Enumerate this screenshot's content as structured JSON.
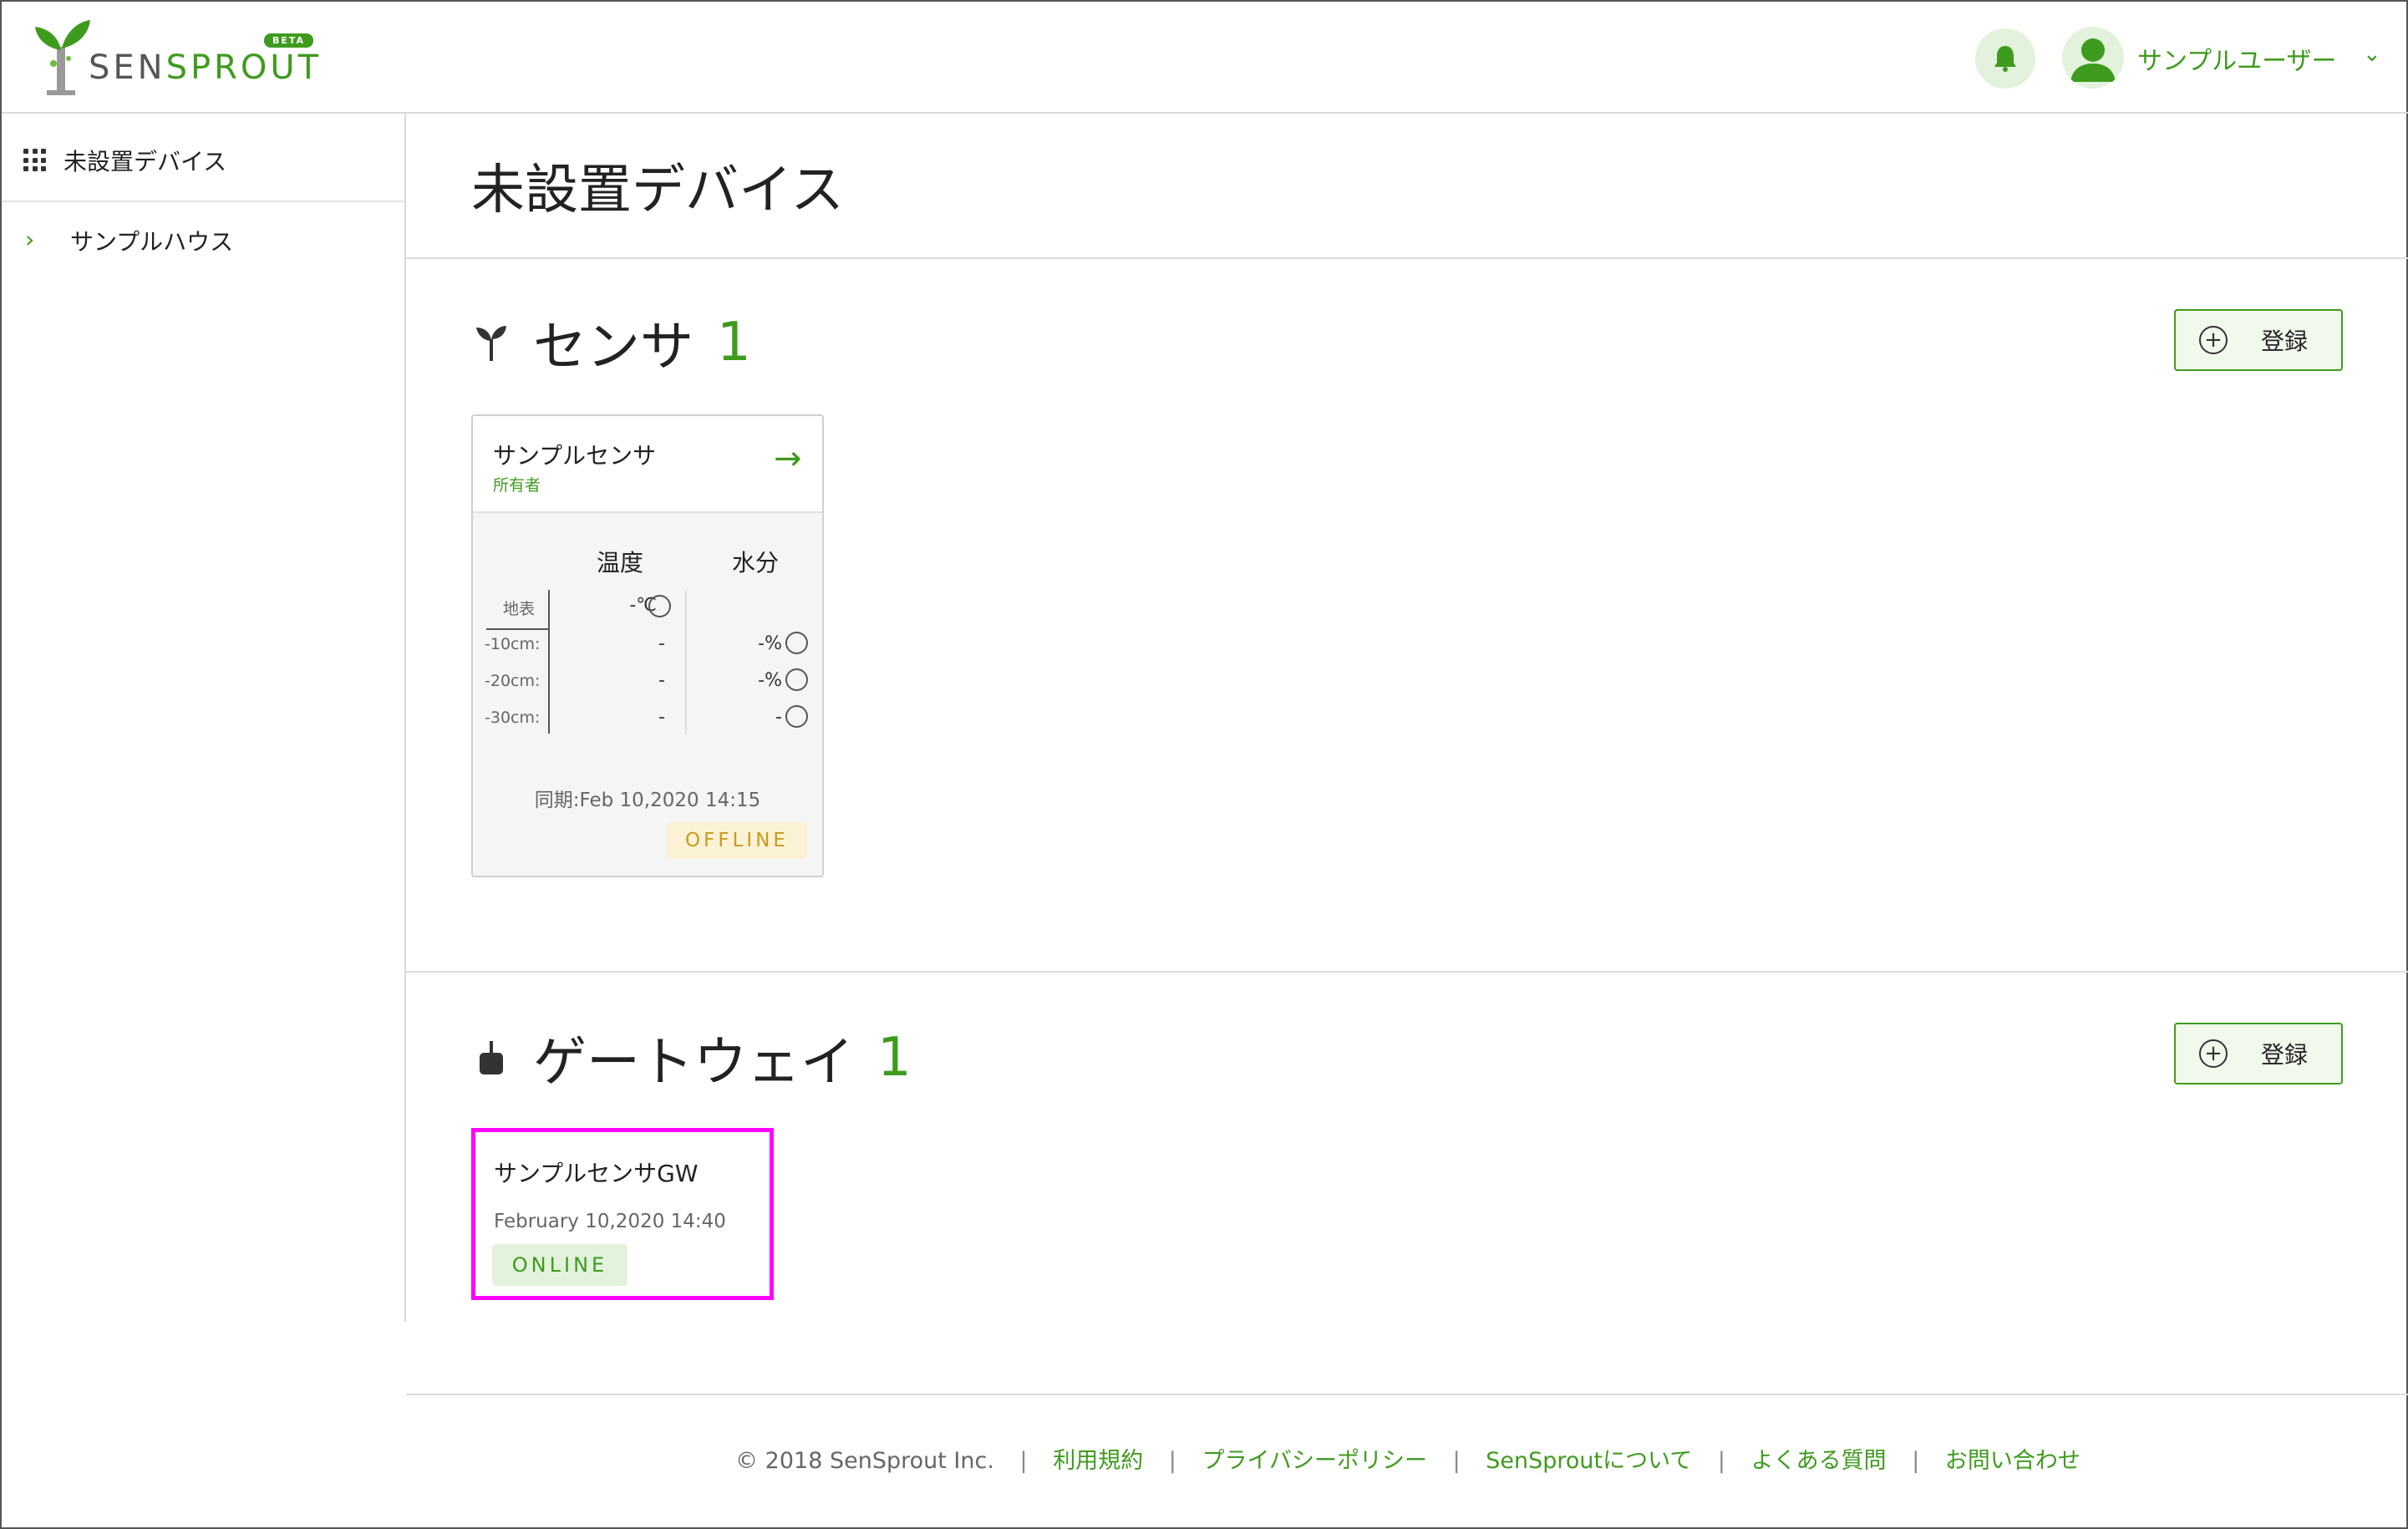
{
  "header": {
    "logo": {
      "sen": "SEN",
      "sprout": "SPROUT",
      "badge": "BETA"
    },
    "bell_icon": "bell-icon",
    "user": {
      "avatar_icon": "user-avatar-icon",
      "name": "サンプルユーザー",
      "chevron": "⌄"
    }
  },
  "sidebar": {
    "unplaced_label": "未設置デバイス",
    "house_chevron": "›",
    "house_label": "サンプルハウス"
  },
  "page": {
    "title": "未設置デバイス"
  },
  "sensors": {
    "heading": "センサ",
    "count": "1",
    "register_label": "登録",
    "card": {
      "name": "サンプルセンサ",
      "role": "所有者",
      "arrow": "→",
      "temp_header": "温度",
      "moisture_header": "水分",
      "rows": [
        {
          "label": "地表",
          "temp": "-℃",
          "moisture": ""
        },
        {
          "label": "-10cm:",
          "temp": "-",
          "moisture": "-%"
        },
        {
          "label": "-20cm:",
          "temp": "-",
          "moisture": "-%"
        },
        {
          "label": "-30cm:",
          "temp": "-",
          "moisture": "-"
        }
      ],
      "sync": "同期:Feb 10,2020 14:15",
      "status": "OFFLINE"
    }
  },
  "gateways": {
    "heading": "ゲートウェイ",
    "count": "1",
    "register_label": "登録",
    "card": {
      "name": "サンプルセンサGW",
      "time": "February 10,2020 14:40",
      "status": "ONLINE"
    }
  },
  "footer": {
    "copyright": "© 2018 SenSprout Inc.",
    "links": [
      "利用規約",
      "プライバシーポリシー",
      "SenSproutについて",
      "よくある質問",
      "お問い合わせ"
    ],
    "separator": "|"
  },
  "colors": {
    "accent": "#3f9b1e",
    "offline": "#c99a1c",
    "highlight": "#ff00ff"
  }
}
